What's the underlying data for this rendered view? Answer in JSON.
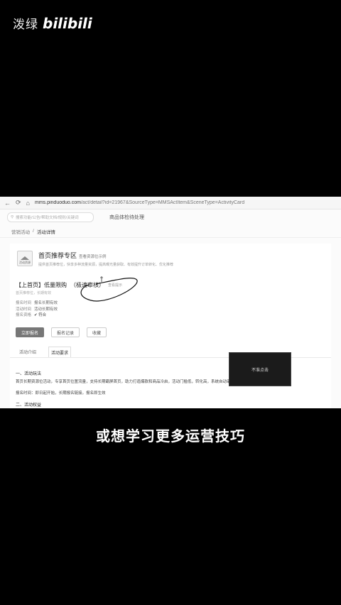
{
  "watermark": {
    "channel": "泼绿",
    "logo": "bilibili"
  },
  "browser": {
    "back": "←",
    "forward": "⟳",
    "home": "⌂",
    "url_host": "mms.pinduoduo.com",
    "url_path": "/act/detail?id=21967&SourceType=MMSActItem&SceneType=ActivityCard"
  },
  "topbar": {
    "search_placeholder": "搜索功能/公告/帮助文档/规则/关键词",
    "link": "商品体检待处理"
  },
  "breadcrumb": {
    "parent": "营销活动",
    "sep": "/",
    "current": "活动详情"
  },
  "activity": {
    "icon_label": "活动资源",
    "title": "首页推荐专区",
    "title_sub": "查看资源位示例",
    "desc": "提供首页推荐位，快享多种流量资源，提高曝光量获取、有效提升订单转化、优化推荐"
  },
  "resource": {
    "title": "【上首页】低量限购",
    "tag": "（极速审核）",
    "link": "查看提示",
    "desc": "首页推荐位，长期有效"
  },
  "info": [
    {
      "k": "报名时间",
      "v": "报名长期有效"
    },
    {
      "k": "活动时间",
      "v": "活动长期有效"
    },
    {
      "k": "报名资格",
      "v": "符合"
    }
  ],
  "buttons": {
    "signup": "立即报名",
    "records": "报名记录",
    "favorite": "收藏"
  },
  "tabs": [
    "活动介绍",
    "活动要求"
  ],
  "content": {
    "h1": "一、活动玩法",
    "p1": "首页长期资源位活动，专享首页位置流量，支持长期霸屏首页，助力打造爆款和商品冷启，活动门槛低，转化高，系统自动审核上线",
    "p2": "报名时间：即日起开始，长期报名链接，报名即生效",
    "h2": "二、活动权益"
  },
  "popup": {
    "text": "不准点击"
  },
  "caption": "或想学习更多运营技巧"
}
